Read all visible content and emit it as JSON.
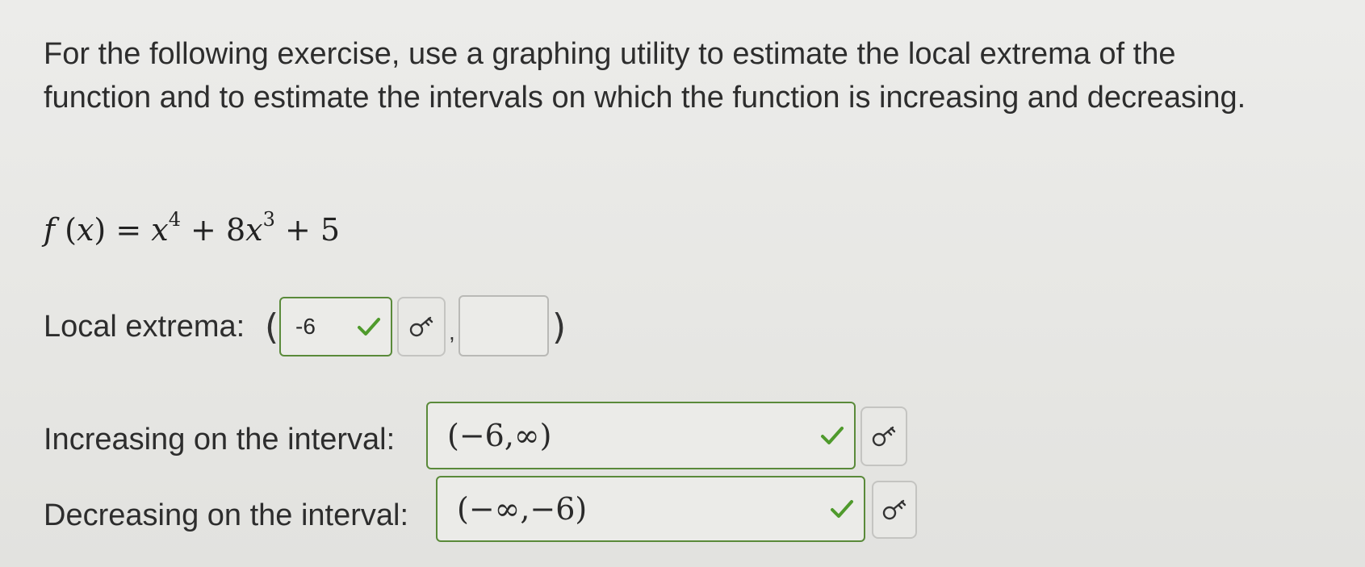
{
  "prompt": "For the following exercise, use a graphing utility to estimate the local extrema of the function and to estimate the intervals on which the function is increasing and decreasing.",
  "formula": {
    "f": "f",
    "arg_open": " (",
    "x": "x",
    "arg_close": ") = ",
    "base1": "x",
    "exp1": "4",
    "mid": " + 8",
    "base2": "x",
    "exp2": "3",
    "tail": " + 5"
  },
  "local_extrema": {
    "label": "Local extrema:",
    "open": "(",
    "comma": ",",
    "close": ")",
    "first_value": "-6",
    "second_value": ""
  },
  "increasing": {
    "label": "Increasing on the interval:",
    "value": "(−6,∞)"
  },
  "decreasing": {
    "label": "Decreasing on the interval:",
    "value": "(−∞,−6)"
  },
  "colors": {
    "correct_border": "#5a8a3a",
    "check": "#4f9a2c"
  }
}
